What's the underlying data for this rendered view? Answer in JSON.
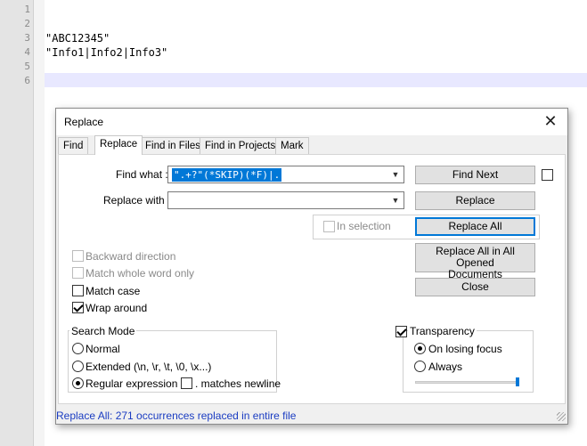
{
  "editor": {
    "line_numbers": [
      "1",
      "2",
      "3",
      "4",
      "5",
      "6"
    ],
    "lines": [
      "",
      "",
      "\"ABC12345\"",
      "\"Info1|Info2|Info3\"",
      "",
      ""
    ]
  },
  "dialog": {
    "title": "Replace",
    "close_glyph": "✕",
    "tabs": [
      "Find",
      "Replace",
      "Find in Files",
      "Find in Projects",
      "Mark"
    ],
    "active_tab": "Replace",
    "find_label": "Find what :",
    "find_value": "\".+?\"(*SKIP)(*F)|.",
    "replace_label": "Replace with :",
    "replace_value": "",
    "in_selection_label": "In selection",
    "buttons": {
      "find_next": "Find Next",
      "replace": "Replace",
      "replace_all": "Replace All",
      "replace_all_opened_line1": "Replace All in All Opened",
      "replace_all_opened_line2": "Documents",
      "close": "Close"
    },
    "options": {
      "backward": "Backward direction",
      "whole_word": "Match whole word only",
      "match_case": "Match case",
      "wrap_around": "Wrap around"
    },
    "search_mode": {
      "legend": "Search Mode",
      "normal": "Normal",
      "extended": "Extended (\\n, \\r, \\t, \\0, \\x...)",
      "regex": "Regular expression",
      "matches_newline": ". matches newline",
      "selected": "regex"
    },
    "transparency": {
      "label": "Transparency",
      "on_losing_focus": "On losing focus",
      "always": "Always",
      "level": 1.0
    },
    "status": "Replace All: 271 occurrences replaced in entire file"
  },
  "colors": {
    "accent": "#0078d7",
    "status_text": "#1a3cc2",
    "current_line": "#e8e8ff"
  }
}
